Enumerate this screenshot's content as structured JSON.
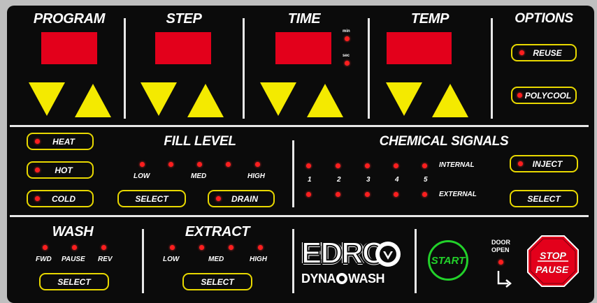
{
  "colors": {
    "panel": "#0b0b0b",
    "display": "#e3001b",
    "arrow": "#f4ea00",
    "button_border": "#e8d800",
    "led": "#ff1e1e",
    "start": "#22d12a",
    "stop": "#e3001b"
  },
  "top": {
    "program": {
      "label": "PROGRAM"
    },
    "step": {
      "label": "STEP"
    },
    "time": {
      "label": "TIME",
      "min_label": "min",
      "sec_label": "sec"
    },
    "temp": {
      "label": "TEMP"
    },
    "options": {
      "label": "OPTIONS",
      "reuse": "REUSE",
      "polycool": "POLYCOOL"
    }
  },
  "middle": {
    "temp_buttons": {
      "heat": "HEAT",
      "hot": "HOT",
      "cold": "COLD"
    },
    "fill_level": {
      "label": "FILL LEVEL",
      "low": "LOW",
      "med": "MED",
      "high": "HIGH",
      "select": "SELECT",
      "drain": "DRAIN"
    },
    "chemical": {
      "label": "CHEMICAL SIGNALS",
      "numbers": [
        "1",
        "2",
        "3",
        "4",
        "5"
      ],
      "internal": "INTERNAL",
      "external": "EXTERNAL",
      "inject": "INJECT",
      "select": "SELECT"
    }
  },
  "bottom": {
    "wash": {
      "label": "WASH",
      "fwd": "FWD",
      "pause": "PAUSE",
      "rev": "REV",
      "select": "SELECT"
    },
    "extract": {
      "label": "EXTRACT",
      "low": "LOW",
      "med": "MED",
      "high": "HIGH",
      "select": "SELECT"
    },
    "logo": {
      "brand": "EDRO",
      "sub": "DYNA",
      "sub2": "WASH"
    },
    "start": "START",
    "door_open": {
      "line1": "DOOR",
      "line2": "OPEN"
    },
    "stop": {
      "line1": "STOP",
      "line2": "PAUSE"
    }
  }
}
